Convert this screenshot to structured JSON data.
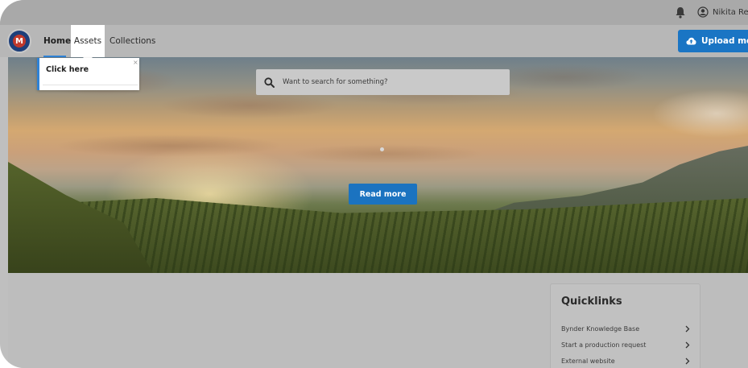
{
  "header": {
    "user_name": "Nikita Ree"
  },
  "nav": {
    "logo_letter": "M",
    "items": [
      {
        "label": "Home"
      },
      {
        "label": "Assets"
      },
      {
        "label": "Collections"
      }
    ],
    "upload_label": "Upload medi"
  },
  "tooltip": {
    "text": "Click here",
    "close": "×"
  },
  "hero": {
    "search_placeholder": "Want to search for something?",
    "read_more_label": "Read more"
  },
  "quicklinks": {
    "title": "Quicklinks",
    "items": [
      {
        "label": "Bynder Knowledge Base"
      },
      {
        "label": "Start a production request"
      },
      {
        "label": "External website"
      }
    ]
  },
  "colors": {
    "accent": "#1b73c0",
    "active_tab_underline": "#2f82d6"
  }
}
